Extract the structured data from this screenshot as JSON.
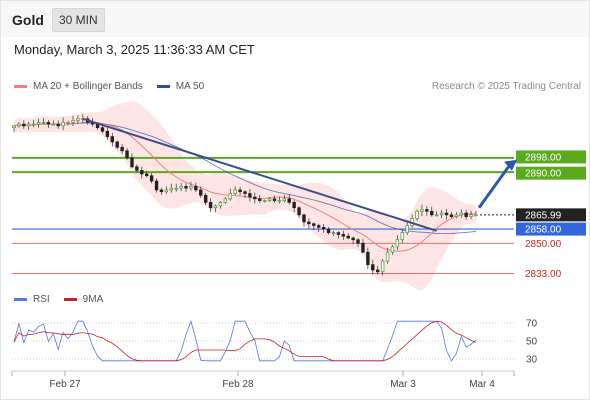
{
  "header": {
    "instrument": "Gold",
    "timeframe": "30 MIN",
    "datetime": "Monday, March 3, 2025 11:36:33 AM CET"
  },
  "legend": {
    "ma20_label": "MA 20 + Bollinger Bands",
    "ma50_label": "MA 50",
    "credit": "Research © 2025 Trading Central"
  },
  "rsi_legend": {
    "rsi_label": "RSI",
    "ma9_label": "9MA"
  },
  "colors": {
    "ma20": "#f08080",
    "ma50": "#334c99",
    "bands_fill": "#fde0e0",
    "resistance": "#5aaa1e",
    "support_blue": "#3366dd",
    "support_red": "#e06060",
    "current": "#222222",
    "rsi": "#5577dd",
    "ma9": "#cc2222",
    "arrow": "#2b5aa6"
  },
  "chart_data": [
    {
      "type": "candlestick",
      "y_range": [
        2826,
        2930
      ],
      "x_ticks": [
        "Feb 27",
        "Feb 28",
        "Mar 3",
        "Mar 4"
      ],
      "levels": [
        {
          "value": 2898.0,
          "label": "2898.00",
          "kind": "resistance"
        },
        {
          "value": 2890.0,
          "label": "2890.00",
          "kind": "resistance"
        },
        {
          "value": 2865.99,
          "label": "2865.99",
          "kind": "current"
        },
        {
          "value": 2858.0,
          "label": "2858.00",
          "kind": "pivot"
        },
        {
          "value": 2850.0,
          "label": "2850.00",
          "kind": "support"
        },
        {
          "value": 2833.0,
          "label": "2833.00",
          "kind": "support"
        }
      ],
      "closes": [
        2916,
        2917,
        2916,
        2917,
        2917,
        2918,
        2918,
        2917,
        2917,
        2916,
        2918,
        2918,
        2919,
        2920,
        2920,
        2918,
        2917,
        2915,
        2913,
        2910,
        2907,
        2904,
        2902,
        2898,
        2893,
        2891,
        2889,
        2888,
        2885,
        2880,
        2879,
        2880,
        2881,
        2881,
        2882,
        2881,
        2882,
        2880,
        2877,
        2873,
        2870,
        2871,
        2873,
        2875,
        2878,
        2880,
        2879,
        2878,
        2876,
        2875,
        2874,
        2874,
        2875,
        2874,
        2874,
        2875,
        2873,
        2870,
        2866,
        2862,
        2861,
        2860,
        2859,
        2858,
        2856,
        2856,
        2855,
        2854,
        2853,
        2852,
        2850,
        2845,
        2838,
        2835,
        2834,
        2840,
        2845,
        2848,
        2852,
        2856,
        2860,
        2864,
        2868,
        2869,
        2868,
        2866,
        2866,
        2867,
        2866,
        2865,
        2866,
        2867,
        2865,
        2866,
        2866
      ]
    },
    {
      "type": "line",
      "title": "RSI",
      "y_ticks": [
        30,
        50,
        70
      ],
      "y_range": [
        20,
        80
      ]
    }
  ]
}
